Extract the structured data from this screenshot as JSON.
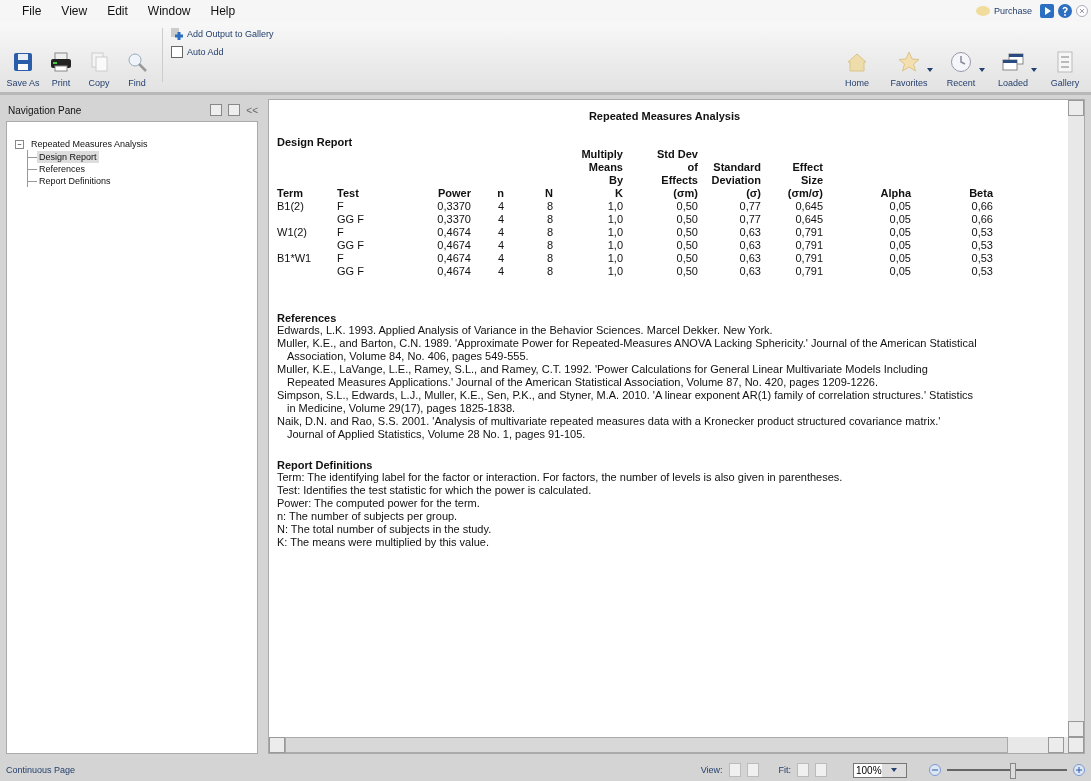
{
  "menu": [
    "File",
    "View",
    "Edit",
    "Window",
    "Help"
  ],
  "top_right": {
    "purchase": "Purchase"
  },
  "toolbar": {
    "left": [
      {
        "label": "Save As"
      },
      {
        "label": "Print"
      },
      {
        "label": "Copy"
      },
      {
        "label": "Find"
      }
    ],
    "add_output": "Add Output to Gallery",
    "auto_add": {
      "label": "Auto Add",
      "checked": false
    },
    "right": [
      {
        "label": "Home",
        "dropdown": false
      },
      {
        "label": "Favorites",
        "dropdown": true
      },
      {
        "label": "Recent",
        "dropdown": true
      },
      {
        "label": "Loaded",
        "dropdown": true
      },
      {
        "label": "Gallery",
        "dropdown": false
      }
    ]
  },
  "navigation_pane": {
    "title": "Navigation Pane",
    "collapse": "<<",
    "tree": [
      {
        "label": "Repeated Measures Analysis",
        "expanded": true,
        "selected": false,
        "children": [
          {
            "label": "Design Report",
            "selected": true
          },
          {
            "label": "References",
            "selected": false
          },
          {
            "label": "Report Definitions",
            "selected": false
          }
        ]
      }
    ]
  },
  "report": {
    "title": "Repeated Measures Analysis",
    "design_heading": "Design Report",
    "columns": [
      "Term",
      "Test",
      "Power",
      "n",
      "N",
      "Multiply\nMeans\nBy\nK",
      "Std Dev\nof\nEffects\n(σm)",
      "Standard\nDeviation\n(σ)",
      "Effect\nSize\n(σm/σ)",
      "Alpha",
      "Beta"
    ],
    "rows": [
      [
        "B1(2)",
        "F",
        "0,3370",
        "4",
        "8",
        "1,0",
        "0,50",
        "0,77",
        "0,645",
        "0,05",
        "0,66"
      ],
      [
        "",
        "GG F",
        "0,3370",
        "4",
        "8",
        "1,0",
        "0,50",
        "0,77",
        "0,645",
        "0,05",
        "0,66"
      ],
      [
        "W1(2)",
        "F",
        "0,4674",
        "4",
        "8",
        "1,0",
        "0,50",
        "0,63",
        "0,791",
        "0,05",
        "0,53"
      ],
      [
        "",
        "GG F",
        "0,4674",
        "4",
        "8",
        "1,0",
        "0,50",
        "0,63",
        "0,791",
        "0,05",
        "0,53"
      ],
      [
        "B1*W1",
        "F",
        "0,4674",
        "4",
        "8",
        "1,0",
        "0,50",
        "0,63",
        "0,791",
        "0,05",
        "0,53"
      ],
      [
        "",
        "GG F",
        "0,4674",
        "4",
        "8",
        "1,0",
        "0,50",
        "0,63",
        "0,791",
        "0,05",
        "0,53"
      ]
    ],
    "references_heading": "References",
    "references": [
      "Edwards, L.K. 1993. Applied Analysis of Variance in the Behavior Sciences. Marcel Dekker. New York.",
      "Muller, K.E., and Barton, C.N. 1989. 'Approximate Power for Repeated-Measures ANOVA Lacking Sphericity.' Journal of the American Statistical Association, Volume 84, No. 406, pages 549-555.",
      "Muller, K.E., LaVange, L.E., Ramey, S.L., and Ramey, C.T. 1992. 'Power Calculations for General Linear Multivariate Models Including Repeated Measures Applications.' Journal of the American Statistical Association, Volume 87, No. 420, pages 1209-1226.",
      "Simpson, S.L., Edwards, L.J., Muller, K.E., Sen, P.K., and Styner, M.A. 2010. 'A linear exponent AR(1) family of correlation structures.' Statistics in Medicine, Volume 29(17), pages 1825-1838.",
      "Naik, D.N. and Rao, S.S. 2001. 'Analysis of multivariate repeated measures data with a Kronecker product structured covariance matrix.' Journal of Applied Statistics, Volume 28 No. 1, pages 91-105."
    ],
    "definitions_heading": "Report Definitions",
    "definitions": [
      "Term: The identifying label for the factor or interaction. For factors, the number of levels is also given in parentheses.",
      "Test: Identifies the test statistic for which the power is calculated.",
      "Power: The computed power for the term.",
      "n: The number of subjects per group.",
      "N: The total number of subjects in the study.",
      "K: The means were multiplied by this value."
    ]
  },
  "status_bar": {
    "mode": "Continuous Page",
    "view_label": "View:",
    "fit_label": "Fit:",
    "zoom": "100%",
    "zoom_slider": {
      "level": 0.55
    }
  }
}
